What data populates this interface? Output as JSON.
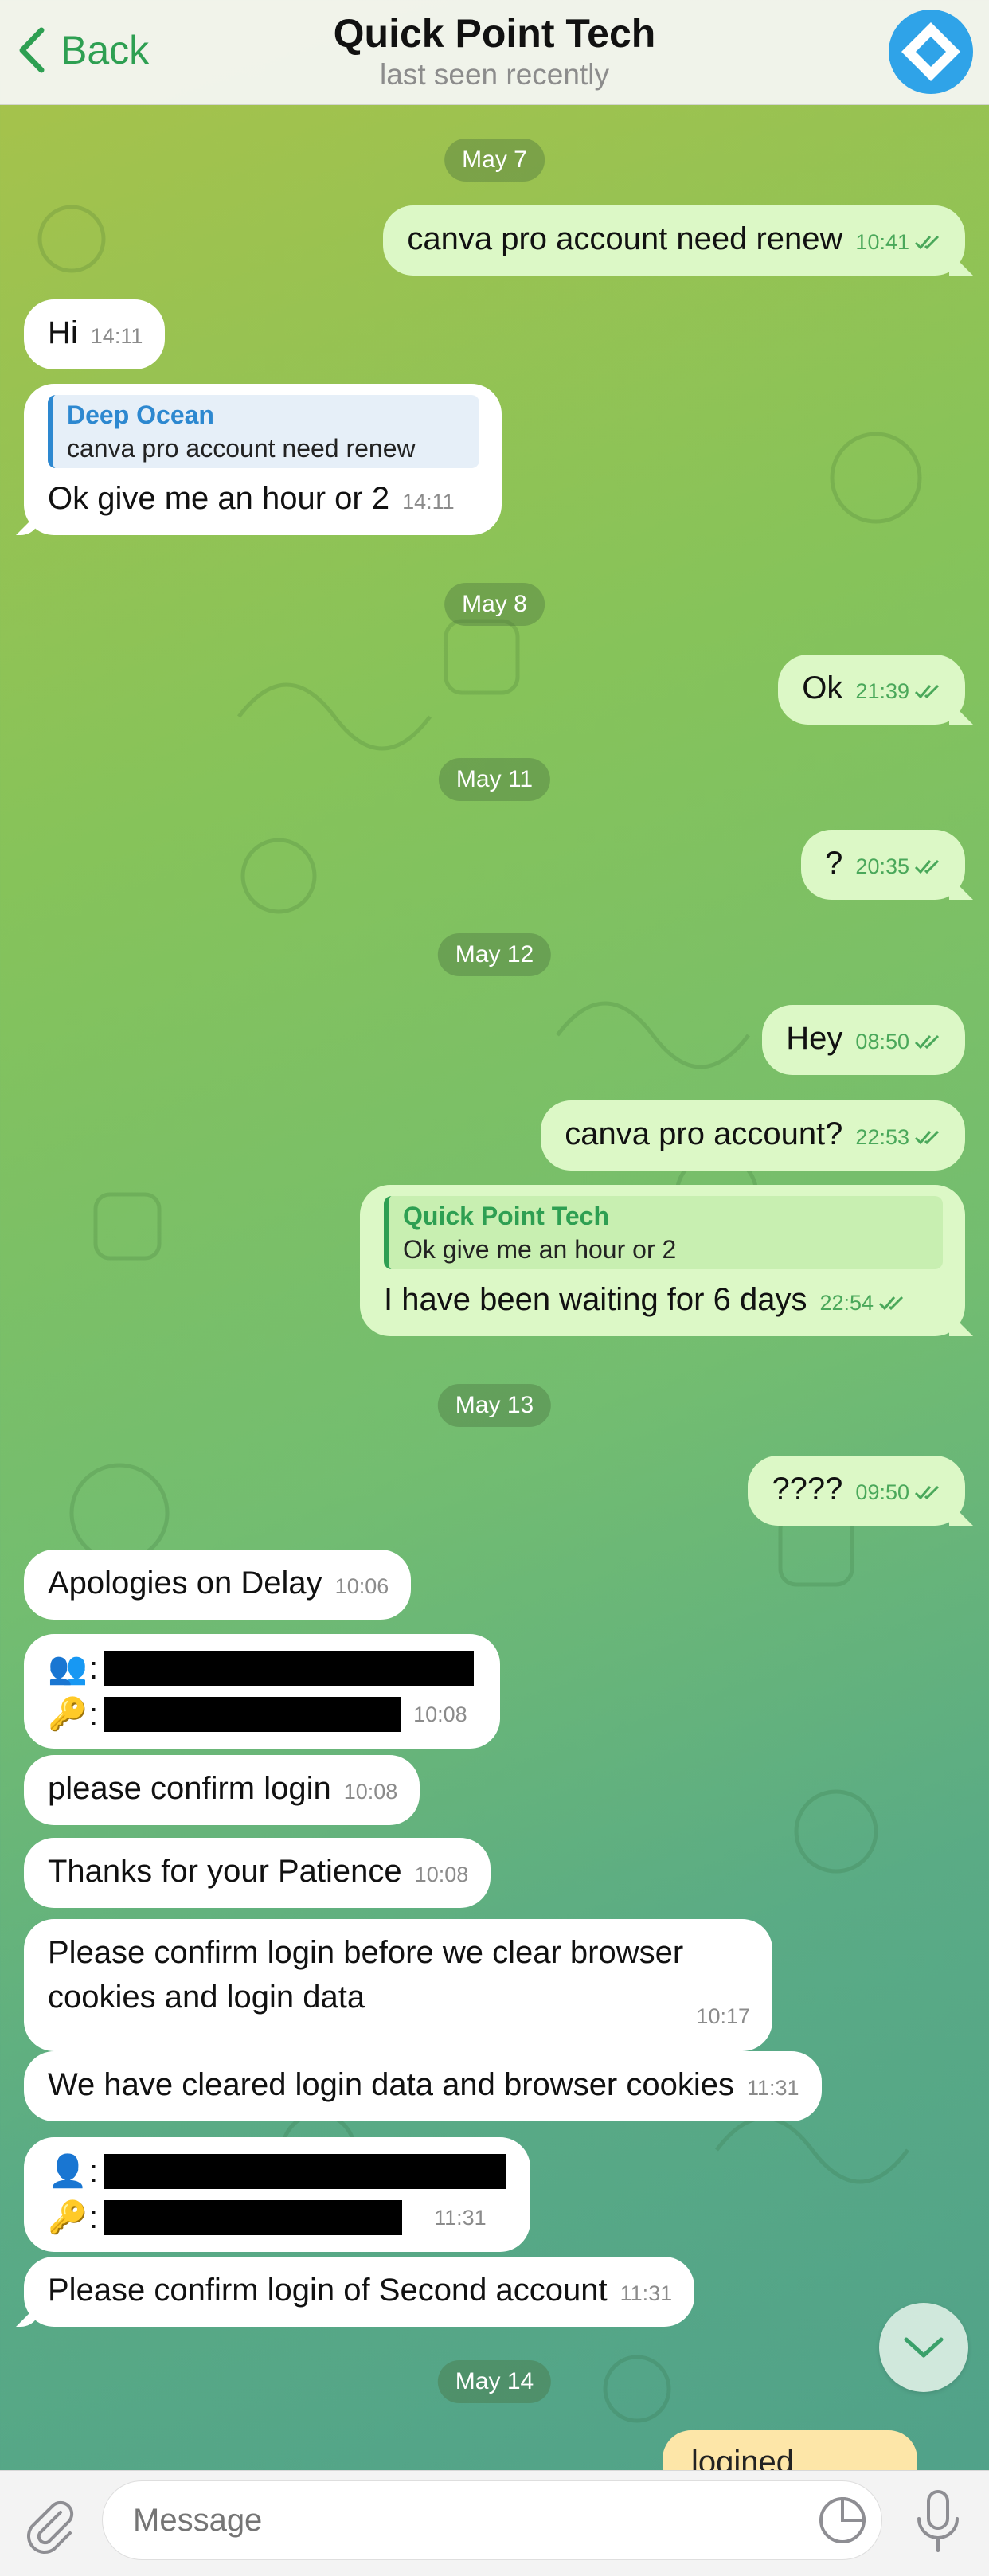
{
  "header": {
    "back_label": "Back",
    "title": "Quick Point Tech",
    "subtitle": "last seen recently"
  },
  "messages": [
    {
      "kind": "date",
      "text": "May 7"
    },
    {
      "kind": "out",
      "text": "canva pro account need renew",
      "time": "10:41"
    },
    {
      "kind": "in",
      "text": "Hi",
      "time": "14:11"
    },
    {
      "kind": "in",
      "reply_name": "Deep Ocean",
      "reply_text": "canva pro account need renew",
      "text": "Ok give me an hour or 2",
      "time": "14:11"
    },
    {
      "kind": "date",
      "text": "May 8"
    },
    {
      "kind": "out",
      "text": "Ok",
      "time": "21:39"
    },
    {
      "kind": "date",
      "text": "May 11"
    },
    {
      "kind": "out",
      "text": "?",
      "time": "20:35"
    },
    {
      "kind": "date",
      "text": "May 12"
    },
    {
      "kind": "out",
      "text": "Hey",
      "time": "08:50"
    },
    {
      "kind": "out",
      "text": "canva pro account?",
      "time": "22:53"
    },
    {
      "kind": "out",
      "reply_name": "Quick Point Tech",
      "reply_text": "Ok give me an hour or 2",
      "text": "I have been waiting for 6 days",
      "time": "22:54"
    },
    {
      "kind": "date",
      "text": "May 13"
    },
    {
      "kind": "out",
      "text": "????",
      "time": "09:50"
    },
    {
      "kind": "in",
      "text": "Apologies on Delay",
      "time": "10:06"
    },
    {
      "kind": "in",
      "cred_emoji_1": "👥",
      "cred_emoji_2": "🔑",
      "separator": ":",
      "time": "10:08"
    },
    {
      "kind": "in",
      "text": "please confirm login",
      "time": "10:08"
    },
    {
      "kind": "in",
      "text": "Thanks for your Patience",
      "time": "10:08"
    },
    {
      "kind": "in",
      "text": "Please confirm login before we clear browser cookies and login data",
      "time": "10:17"
    },
    {
      "kind": "in",
      "text": "We have cleared login data and browser cookies",
      "time": "11:31"
    },
    {
      "kind": "in",
      "cred_emoji_1": "👤",
      "cred_emoji_2": "🔑",
      "separator": ":",
      "time": "11:31"
    },
    {
      "kind": "in",
      "text": "Please confirm login of Second account",
      "time": "11:31"
    },
    {
      "kind": "date",
      "text": "May 14"
    },
    {
      "kind": "out",
      "text": "logined",
      "time": ""
    }
  ],
  "composer": {
    "placeholder": "Message"
  },
  "icons": {
    "back": "chevron-left-icon",
    "avatar": "diamond-logo-icon",
    "check": "double-check-icon",
    "scroll": "chevron-down-icon",
    "attach": "paperclip-icon",
    "sticker": "sticker-icon",
    "mic": "microphone-icon"
  },
  "colors": {
    "accent": "#2e9f52",
    "outgoing_bubble": "#dcf8c6",
    "incoming_bubble": "#ffffff",
    "avatar_bg": "#2fa3e8"
  }
}
